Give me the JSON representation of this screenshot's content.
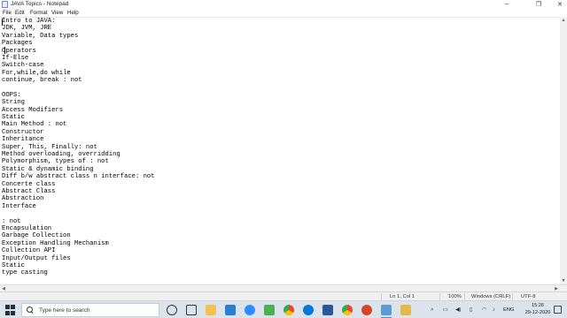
{
  "window": {
    "title": "JAVA Topics - Notepad",
    "minimize": "─",
    "maximize": "❐",
    "close": "✕"
  },
  "menu": {
    "items": [
      "File",
      "Edit",
      "Format",
      "View",
      "Help"
    ]
  },
  "editor": {
    "lines": [
      "Intro to JAVA:",
      "JDK, JVM, JRE",
      "Variable, Data types",
      "Packages",
      "Operators",
      "If-Else",
      "Switch-case",
      "For,while,do while",
      "continue, break : not",
      "",
      "OOPS:",
      "String",
      "Access Modifiers",
      "Static",
      "Main Method : not",
      "Constructor",
      "Inheritance",
      "Super, This, Finally: not",
      "Method overloading, overridding",
      "Polymorphism, types of : not",
      "Static & dynamic binding",
      "Diff b/w abstract class n interface: not",
      "Concerte class",
      "Abstract Class",
      "Abstraction",
      "Interface",
      "",
      ": not",
      "Encapsulation",
      "Garbage Collection",
      "Exception Handling Mechanism",
      "Collection API",
      "Input/Output files",
      "Static",
      "type casting"
    ]
  },
  "statusbar": {
    "position": "Ln 1, Col 1",
    "zoom": "100%",
    "line_ending": "Windows (CRLF)",
    "encoding": "UTF-8"
  },
  "taskbar": {
    "search_placeholder": "Type here to search",
    "language": "ENG",
    "time": "15:26",
    "date": "29-12-2020",
    "icon_colors": {
      "cortana": "#2b2b2b",
      "taskview": "#2b2b2b",
      "explorer": "#f2c14e",
      "store": "#2d7dd2",
      "zoom": "#2d8cff",
      "photos": "#4caf50",
      "chrome": "#ea4335",
      "edge": "#0078d7",
      "word": "#2b579a",
      "powerpoint": "#d24726",
      "chrome2": "#34a853",
      "notepad": "#5b9bd5",
      "explorer2": "#e6b84a"
    }
  }
}
